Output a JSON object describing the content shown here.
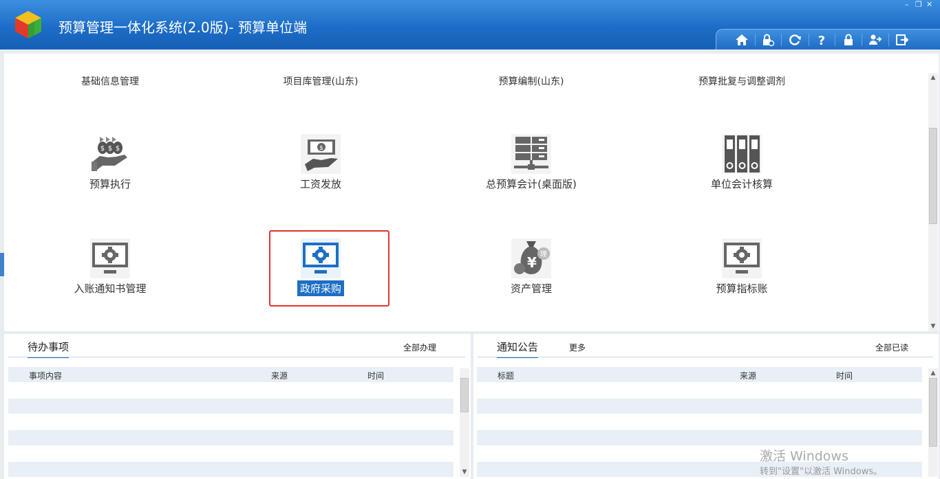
{
  "app": {
    "title": "预算管理一体化系统(2.0版)- 预算单位端",
    "brand_colors": {
      "titlebar": "#1d6dc7",
      "selected": "#1d6fc4",
      "highlight_border": "#e3332c"
    }
  },
  "window_controls": {
    "minimize": "–",
    "maximize": "❐",
    "close": "✕"
  },
  "toolbar": {
    "icons": [
      "home-icon",
      "lock-settings-icon",
      "refresh-icon",
      "help-icon",
      "lock-icon",
      "user-switch-icon",
      "exit-icon"
    ]
  },
  "categories": [
    "基础信息管理",
    "项目库管理(山东)",
    "预算编制(山东)",
    "预算批复与调整调剂"
  ],
  "modules": {
    "row1": [
      {
        "label": "预算执行",
        "icon": "money-hand-icon"
      },
      {
        "label": "工资发放",
        "icon": "salary-icon"
      },
      {
        "label": "总预算会计(桌面版)",
        "icon": "server-icon"
      },
      {
        "label": "单位会计核算",
        "icon": "binders-icon"
      }
    ],
    "row2": [
      {
        "label": "入账通知书管理",
        "icon": "monitor-gear-icon"
      },
      {
        "label": "政府采购",
        "icon": "monitor-gear-blue-icon",
        "selected": true
      },
      {
        "label": "资产管理",
        "icon": "money-bag-icon"
      },
      {
        "label": "预算指标账",
        "icon": "monitor-gear-icon"
      }
    ]
  },
  "todo_panel": {
    "tab": "待办事项",
    "link_all": "全部办理",
    "columns": [
      "事项内容",
      "来源",
      "时间"
    ]
  },
  "notice_panel": {
    "tab": "通知公告",
    "link_more": "更多",
    "link_read_all": "全部已读",
    "columns": [
      "标题",
      "来源",
      "时间"
    ]
  },
  "watermark": {
    "line1": "激活 Windows",
    "line2": "转到\"设置\"以激活 Windows。"
  }
}
